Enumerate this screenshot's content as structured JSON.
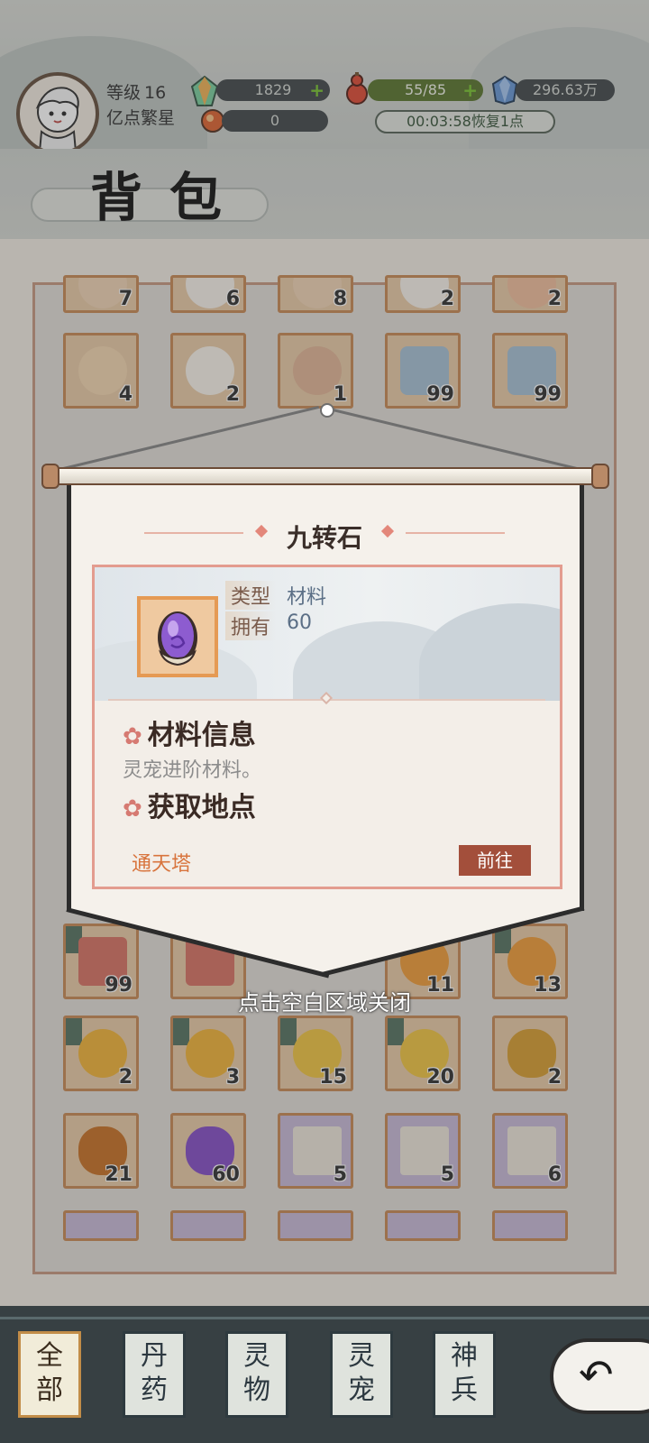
{
  "player": {
    "level_label": "等级",
    "level": "16",
    "nickname": "亿点繁星"
  },
  "resources": {
    "jade": "1829",
    "orb": "0",
    "stamina": "55/85",
    "crystal": "296.63万",
    "recover_timer": "00:03:58恢复1点",
    "plus_symbol": "+"
  },
  "page_title": "背包",
  "grid": {
    "row1_counts": [
      "7",
      "6",
      "8",
      "2",
      "2"
    ],
    "row2_counts": [
      "4",
      "2",
      "1",
      "99",
      "99"
    ],
    "row3_counts": [
      "99",
      "",
      "11",
      "13"
    ],
    "row4_counts": [
      "2",
      "3",
      "15",
      "20",
      "2"
    ],
    "row5_counts": [
      "21",
      "60",
      "5",
      "5",
      "6"
    ]
  },
  "popup": {
    "item_name": "九转石",
    "type_label": "类型",
    "type_value": "材料",
    "own_label": "拥有",
    "own_value": "60",
    "info_title": "材料信息",
    "info_desc": "灵宠进阶材料。",
    "source_title": "获取地点",
    "source_place": "通天塔",
    "go_label": "前往",
    "close_hint": "点击空白区域关闭"
  },
  "tabs": [
    {
      "label_top": "全",
      "label_bottom": "部"
    },
    {
      "label_top": "丹",
      "label_bottom": "药"
    },
    {
      "label_top": "灵",
      "label_bottom": "物"
    },
    {
      "label_top": "灵",
      "label_bottom": "宠"
    },
    {
      "label_top": "神",
      "label_bottom": "兵"
    }
  ],
  "colors": {
    "accent": "#a34f3b",
    "place": "#d8743d",
    "stamina": "#607a36"
  }
}
